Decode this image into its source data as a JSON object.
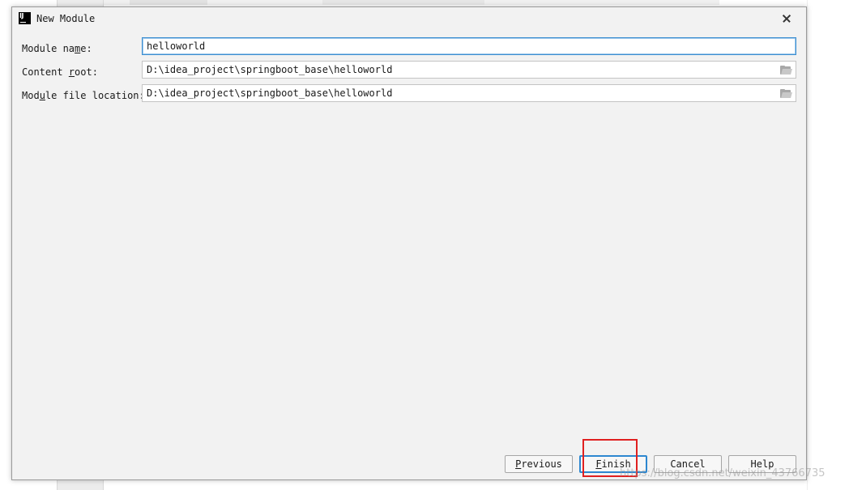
{
  "dialog": {
    "title": "New Module",
    "app_icon_text": "IJ"
  },
  "form": {
    "module_name": {
      "label_pre": "Module na",
      "label_mnemonic": "m",
      "label_post": "e:",
      "value": "helloworld"
    },
    "content_root": {
      "label_pre": "Content ",
      "label_mnemonic": "r",
      "label_post": "oot:",
      "value": "D:\\idea_project\\springboot_base\\helloworld"
    },
    "module_file_location": {
      "label_pre": "Mod",
      "label_mnemonic": "u",
      "label_post": "le file location:",
      "value": "D:\\idea_project\\springboot_base\\helloworld"
    }
  },
  "buttons": {
    "previous": {
      "mnemonic": "P",
      "rest": "revious"
    },
    "finish": {
      "mnemonic": "F",
      "rest": "inish"
    },
    "cancel": {
      "label": "Cancel"
    },
    "help": {
      "label": "Help"
    }
  },
  "watermark": "https://blog.csdn.net/weixin_43766735",
  "colors": {
    "focus_border": "#3d8fd1",
    "default_button_border": "#2d87d0",
    "annotation_box": "#e02020",
    "dialog_bg": "#f2f2f2"
  },
  "icons": {
    "app": "intellij-logo-icon",
    "close": "close-icon",
    "browse": "folder-icon"
  }
}
